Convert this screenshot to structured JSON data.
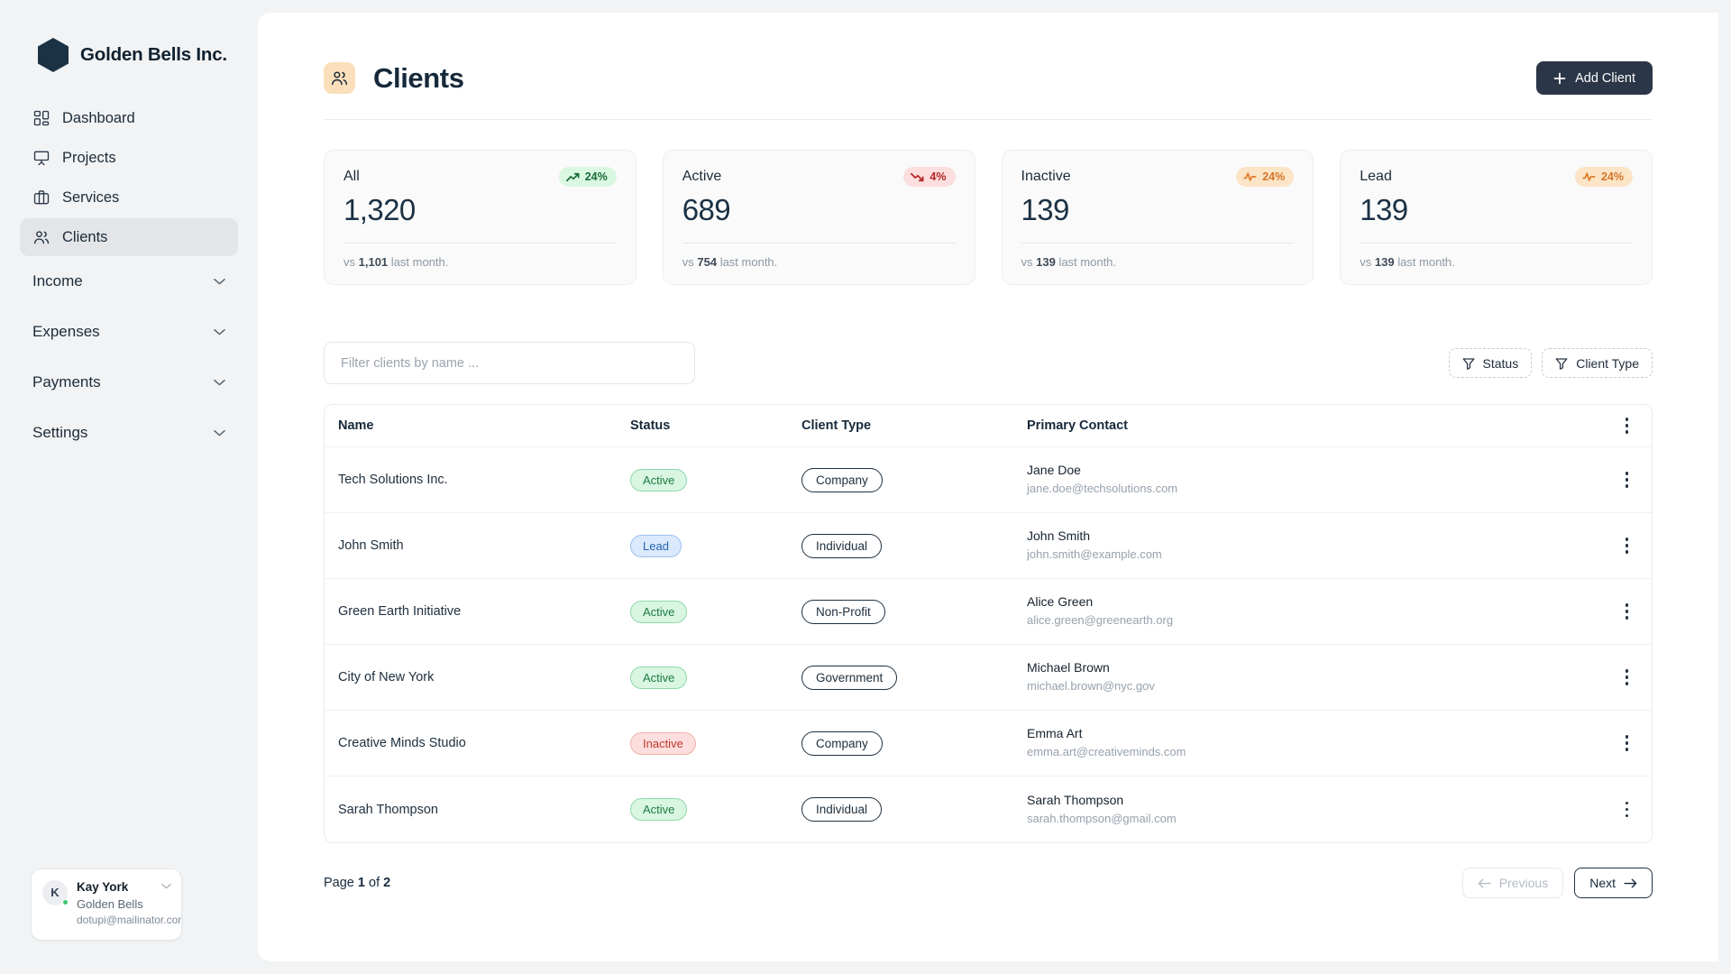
{
  "brand": {
    "name": "Golden Bells Inc.",
    "logo_color": "#1b3144"
  },
  "sidebar": {
    "nav": [
      {
        "label": "Dashboard",
        "icon": "dashboard-grid-icon",
        "active": false
      },
      {
        "label": "Projects",
        "icon": "presentation-icon",
        "active": false
      },
      {
        "label": "Services",
        "icon": "briefcase-icon",
        "active": false
      },
      {
        "label": "Clients",
        "icon": "users-icon",
        "active": true
      }
    ],
    "groups": [
      {
        "label": "Income"
      },
      {
        "label": "Expenses"
      },
      {
        "label": "Payments"
      },
      {
        "label": "Settings"
      }
    ],
    "user": {
      "initial": "K",
      "name": "Kay York",
      "org": "Golden Bells",
      "email": "dotupi@mailinator.cor",
      "status": "online"
    }
  },
  "header": {
    "title": "Clients",
    "icon": "users-icon",
    "icon_bg": "#fbdfbb",
    "add_button": {
      "label": "Add Client",
      "icon": "plus-icon"
    }
  },
  "stats": [
    {
      "label": "All",
      "value": "1,320",
      "delta": "24%",
      "trend": "up",
      "note_prefix": "vs ",
      "note_value": "1,101",
      "note_suffix": " last month."
    },
    {
      "label": "Active",
      "value": "689",
      "delta": "4%",
      "trend": "down",
      "note_prefix": "vs ",
      "note_value": "754",
      "note_suffix": " last month."
    },
    {
      "label": "Inactive",
      "value": "139",
      "delta": "24%",
      "trend": "flat",
      "note_prefix": "vs ",
      "note_value": "139",
      "note_suffix": " last month."
    },
    {
      "label": "Lead",
      "value": "139",
      "delta": "24%",
      "trend": "flat",
      "note_prefix": "vs ",
      "note_value": "139",
      "note_suffix": " last month."
    }
  ],
  "toolbar": {
    "search_placeholder": "Filter clients by name ...",
    "search_value": "",
    "filters": [
      {
        "label": "Status",
        "icon": "funnel-icon"
      },
      {
        "label": "Client Type",
        "icon": "funnel-icon"
      }
    ]
  },
  "table": {
    "columns": [
      "Name",
      "Status",
      "Client Type",
      "Primary Contact"
    ],
    "rows": [
      {
        "name": "Tech Solutions Inc.",
        "status": "Active",
        "status_kind": "active",
        "type": "Company",
        "contact_name": "Jane Doe",
        "contact_email": "jane.doe@techsolutions.com"
      },
      {
        "name": "John Smith",
        "status": "Lead",
        "status_kind": "lead",
        "type": "Individual",
        "contact_name": "John Smith",
        "contact_email": "john.smith@example.com"
      },
      {
        "name": "Green Earth Initiative",
        "status": "Active",
        "status_kind": "active",
        "type": "Non-Profit",
        "contact_name": "Alice Green",
        "contact_email": "alice.green@greenearth.org"
      },
      {
        "name": "City of New York",
        "status": "Active",
        "status_kind": "active",
        "type": "Government",
        "contact_name": "Michael Brown",
        "contact_email": "michael.brown@nyc.gov"
      },
      {
        "name": "Creative Minds Studio",
        "status": "Inactive",
        "status_kind": "inactive",
        "type": "Company",
        "contact_name": "Emma Art",
        "contact_email": "emma.art@creativeminds.com"
      },
      {
        "name": "Sarah Thompson",
        "status": "Active",
        "status_kind": "active",
        "type": "Individual",
        "contact_name": "Sarah Thompson",
        "contact_email": "sarah.thompson@gmail.com"
      }
    ]
  },
  "pagination": {
    "info_prefix": "Page ",
    "current_page": "1",
    "info_mid": " of ",
    "total_pages": "2",
    "previous_label": "Previous",
    "next_label": "Next",
    "previous_enabled": false,
    "next_enabled": true
  }
}
